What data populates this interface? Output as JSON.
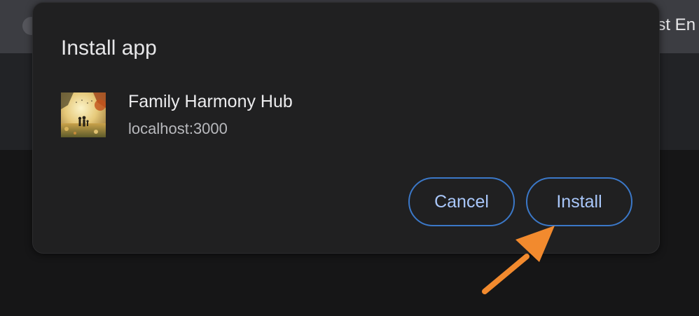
{
  "background": {
    "tab_text": "est En"
  },
  "dialog": {
    "title": "Install app",
    "app_name": "Family Harmony Hub",
    "app_origin": "localhost:3000",
    "cancel_label": "Cancel",
    "install_label": "Install"
  },
  "colors": {
    "dialog_bg": "#202021",
    "button_border": "#3b78c8",
    "button_text": "#a9c7fa",
    "arrow": "#f28a2e"
  }
}
